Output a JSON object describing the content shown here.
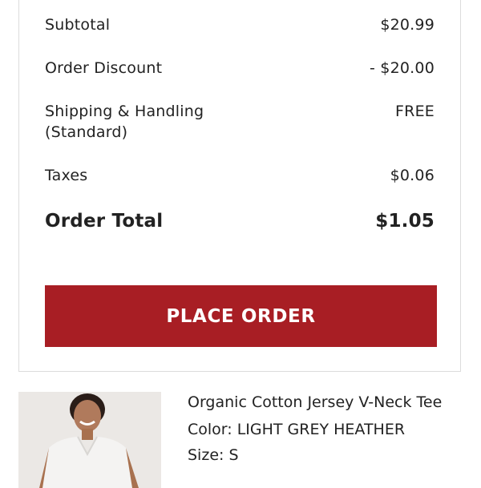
{
  "summary": {
    "subtotal_label": "Subtotal",
    "subtotal_value": "$20.99",
    "discount_label": "Order Discount",
    "discount_value": "- $20.00",
    "shipping_label_line1": "Shipping & Handling",
    "shipping_label_line2": "(Standard)",
    "shipping_value": "FREE",
    "taxes_label": "Taxes",
    "taxes_value": "$0.06",
    "total_label": "Order Total",
    "total_value": "$1.05"
  },
  "actions": {
    "place_order_label": "PLACE ORDER"
  },
  "product": {
    "name": "Organic Cotton Jersey V-Neck Tee",
    "color_line": "Color: LIGHT GREY HEATHER",
    "size_line": "Size: S"
  },
  "colors": {
    "accent": "#a81e24",
    "text": "#222222",
    "border": "#dcdcdc"
  }
}
